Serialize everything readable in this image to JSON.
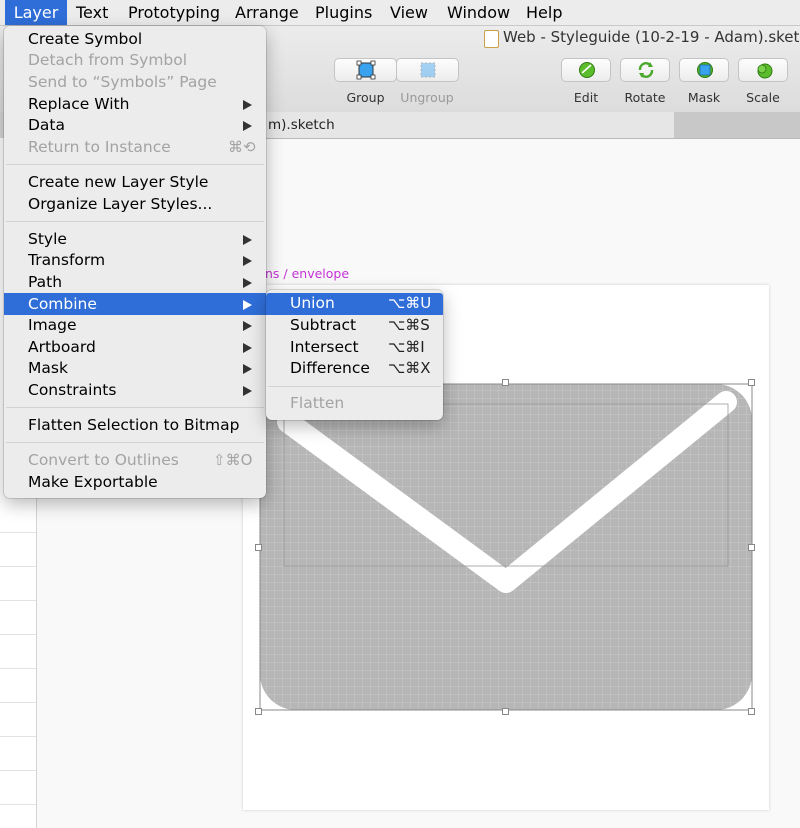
{
  "menubar": {
    "items": [
      "Layer",
      "Text",
      "Prototyping",
      "Arrange",
      "Plugins",
      "View",
      "Window",
      "Help"
    ],
    "active": "Layer"
  },
  "window": {
    "title": "Web - Styleguide (10-2-19 - Adam).sketch"
  },
  "toolbar": {
    "group_label": "Group",
    "ungroup_label": "Ungroup",
    "edit_label": "Edit",
    "rotate_label": "Rotate",
    "mask_label": "Mask",
    "scale_label": "Scale"
  },
  "tab": {
    "label": "m).sketch"
  },
  "canvas": {
    "artboard_label": "ns / envelope"
  },
  "layer_menu": {
    "items": [
      {
        "label": "Create Symbol",
        "enabled": true
      },
      {
        "label": "Detach from Symbol",
        "enabled": false
      },
      {
        "label": "Send to “Symbols” Page",
        "enabled": false
      },
      {
        "label": "Replace With",
        "enabled": true,
        "submenu": true
      },
      {
        "label": "Data",
        "enabled": true,
        "submenu": true
      },
      {
        "label": "Return to Instance",
        "enabled": false,
        "shortcut": "⌘⟲"
      },
      {
        "label": "Create new Layer Style",
        "enabled": true
      },
      {
        "label": "Organize Layer Styles...",
        "enabled": true
      },
      {
        "label": "Style",
        "enabled": true,
        "submenu": true
      },
      {
        "label": "Transform",
        "enabled": true,
        "submenu": true
      },
      {
        "label": "Path",
        "enabled": true,
        "submenu": true
      },
      {
        "label": "Combine",
        "enabled": true,
        "submenu": true,
        "selected": true
      },
      {
        "label": "Image",
        "enabled": true,
        "submenu": true
      },
      {
        "label": "Artboard",
        "enabled": true,
        "submenu": true
      },
      {
        "label": "Mask",
        "enabled": true,
        "submenu": true
      },
      {
        "label": "Constraints",
        "enabled": true,
        "submenu": true
      },
      {
        "label": "Flatten Selection to Bitmap",
        "enabled": true
      },
      {
        "label": "Convert to Outlines",
        "enabled": false,
        "shortcut": "⇧⌘O"
      },
      {
        "label": "Make Exportable",
        "enabled": true
      }
    ]
  },
  "combine_menu": {
    "items": [
      {
        "label": "Union",
        "shortcut": "⌥⌘U",
        "enabled": true,
        "selected": true
      },
      {
        "label": "Subtract",
        "shortcut": "⌥⌘S",
        "enabled": true
      },
      {
        "label": "Intersect",
        "shortcut": "⌥⌘I",
        "enabled": true
      },
      {
        "label": "Difference",
        "shortcut": "⌥⌘X",
        "enabled": true
      },
      {
        "label": "Flatten",
        "enabled": false
      }
    ]
  },
  "colors": {
    "selection": "#2f6ed8",
    "menu_bg": "#ececec",
    "artboard_label": "#c532d6",
    "envelope_fill": "#b6b6b6"
  },
  "icons": {
    "group": "group-icon",
    "ungroup": "ungroup-icon",
    "edit": "edit-icon",
    "rotate": "rotate-icon",
    "mask": "mask-icon",
    "scale": "scale-icon",
    "document": "sketch-document-icon"
  }
}
